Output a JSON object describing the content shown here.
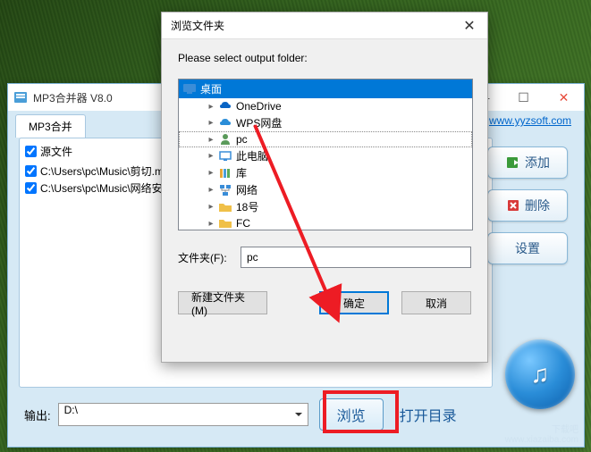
{
  "main": {
    "title": "MP3合并器 V8.0",
    "tab_label": "MP3合并",
    "link": "www.yyzsoft.com",
    "file_header": "源文件",
    "files": [
      "C:\\Users\\pc\\Music\\剪切.m",
      "C:\\Users\\pc\\Music\\网络安"
    ],
    "side": {
      "add": "添加",
      "del": "删除",
      "settings": "设置"
    },
    "output": {
      "label": "输出:",
      "value": "D:\\",
      "browse": "浏览",
      "open_dir": "打开目录"
    },
    "watermark_1": "下载吧",
    "watermark_2": "www.xiazaiba.com"
  },
  "dialog": {
    "title": "浏览文件夹",
    "prompt": "Please select output folder:",
    "root": "桌面",
    "items": [
      "OneDrive",
      "WPS网盘",
      "pc",
      "此电脑",
      "库",
      "网络",
      "18号",
      "FC"
    ],
    "folder_label": "文件夹(F):",
    "folder_value": "pc",
    "new_folder": "新建文件夹(M)",
    "ok": "确定",
    "cancel": "取消"
  }
}
